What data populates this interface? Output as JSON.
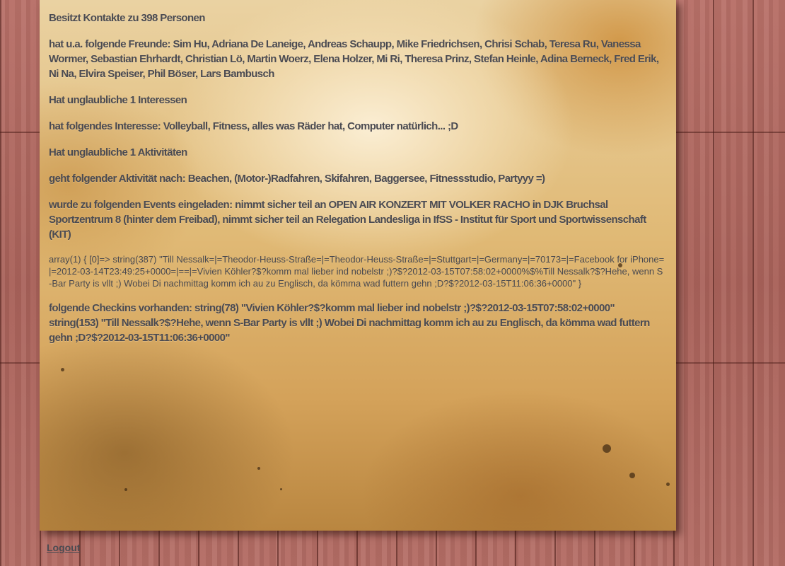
{
  "content": {
    "contacts": "Besitzt Kontakte zu 398 Personen",
    "friends": "hat u.a. folgende Freunde: Sim Hu, Adriana De Laneige, Andreas Schaupp, Mike Friedrichsen, Chrisi Schab, Teresa Ru, Vanessa Wormer, Sebastian Ehrhardt, Christian Lö, Martin Woerz, Elena Holzer, Mi Ri, Theresa Prinz, Stefan Heinle, Adina Berneck, Fred Erik, Ni Na, Elvira Speiser, Phil Böser, Lars Bambusch",
    "interests_count": "Hat unglaubliche 1 Interessen",
    "interest": "hat folgendes Interesse: Volleyball, Fitness, alles was Räder hat, Computer natürlich... ;D",
    "activities_count": "Hat unglaubliche 1 Aktivitäten",
    "activity": "geht folgender Aktivität nach: Beachen, (Motor-)Radfahren, Skifahren, Baggersee, Fitnessstudio, Partyyy =)",
    "events": "wurde zu folgenden Events eingeladen: nimmt sicher teil an OPEN AIR KONZERT MIT VOLKER RACHO in DJK Bruchsal Sportzentrum 8 (hinter dem Freibad), nimmt sicher teil an Relegation Landesliga in IfSS - Institut für Sport und Sportwissenschaft (KIT)",
    "debug_dump": "array(1) { [0]=> string(387) \"Till Nessalk=|=Theodor-Heuss-Straße=|=Theodor-Heuss-Straße=|=Stuttgart=|=Germany=|=70173=|=Facebook for iPhone=|=2012-03-14T23:49:25+0000=|==|=Vivien Köhler?$?komm mal lieber ind nobelstr ;)?$?2012-03-15T07:58:02+0000%$%Till Nessalk?$?Hehe, wenn S-Bar Party is vllt ;) Wobei Di nachmittag komm ich au zu Englisch, da kömma wad futtern gehn ;D?$?2012-03-15T11:06:36+0000\" }",
    "checkins": "folgende Checkins vorhanden: string(78) \"Vivien Köhler?$?komm mal lieber ind nobelstr ;)?$?2012-03-15T07:58:02+0000\" string(153) \"Till Nessalk?$?Hehe, wenn S-Bar Party is vllt ;) Wobei Di nachmittag komm ich au zu Englisch, da kömma wad futtern gehn ;D?$?2012-03-15T11:06:36+0000\""
  },
  "footer": {
    "logout_label": "Logout"
  },
  "colors": {
    "text": "#4b4b52",
    "wood": "#b56e66",
    "paper": "#e0b975"
  }
}
